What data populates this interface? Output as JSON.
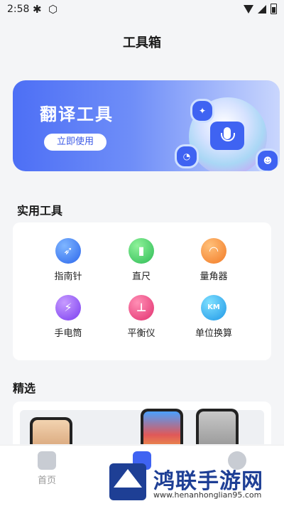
{
  "status_bar": {
    "time": "2:58"
  },
  "header": {
    "title": "工具箱"
  },
  "banner": {
    "title": "翻译工具",
    "button_label": "立即使用"
  },
  "tools_section": {
    "title": "实用工具",
    "items": [
      {
        "label": "指南针",
        "icon": "compass-icon"
      },
      {
        "label": "直尺",
        "icon": "ruler-icon"
      },
      {
        "label": "量角器",
        "icon": "protractor-icon"
      },
      {
        "label": "手电筒",
        "icon": "flashlight-icon"
      },
      {
        "label": "平衡仪",
        "icon": "level-icon"
      },
      {
        "label": "单位换算",
        "icon": "unit-convert-icon"
      }
    ]
  },
  "featured_section": {
    "title": "精选"
  },
  "tabbar": {
    "items": [
      {
        "label": "首页"
      }
    ]
  },
  "watermark": {
    "text": "鸿联手游网",
    "url": "www.henanhonglian95.com"
  }
}
